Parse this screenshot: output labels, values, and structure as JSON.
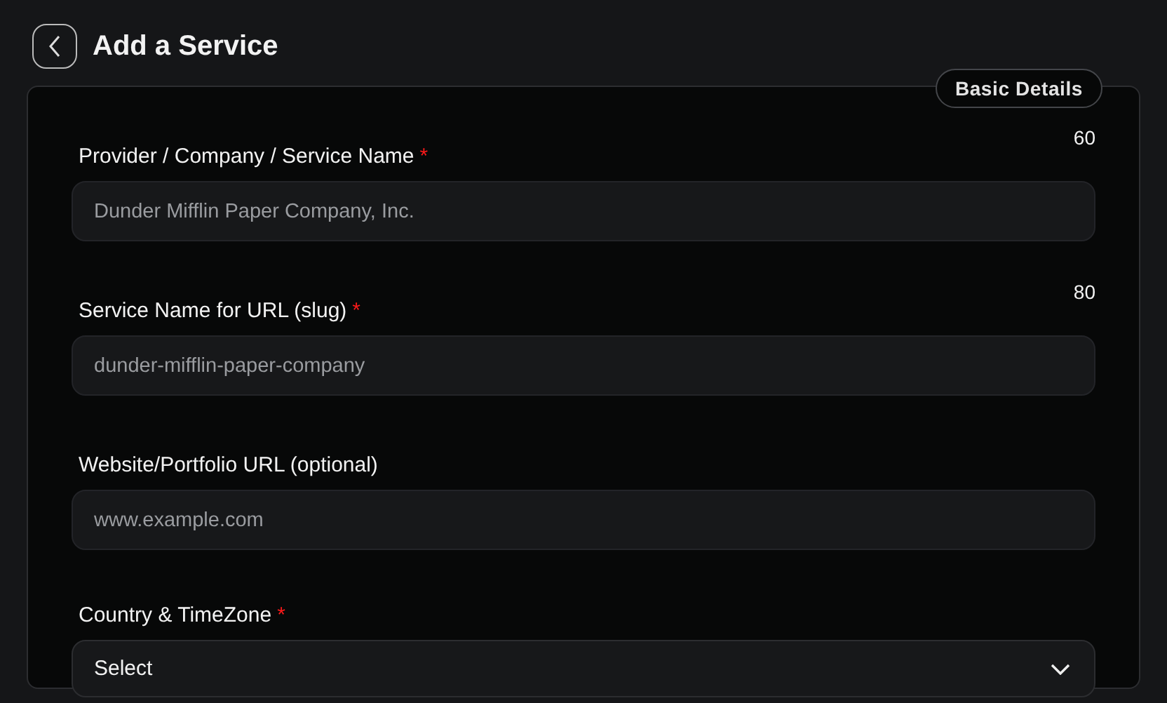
{
  "header": {
    "title": "Add a Service"
  },
  "section": {
    "badge": "Basic Details"
  },
  "fields": [
    {
      "kind": "text",
      "label": "Provider / Company / Service Name",
      "required_mark": "*",
      "counter": "60",
      "placeholder": "Dunder Mifflin Paper Company, Inc."
    },
    {
      "kind": "text",
      "label": "Service Name for URL (slug)",
      "required_mark": "*",
      "counter": "80",
      "placeholder": "dunder-mifflin-paper-company"
    },
    {
      "kind": "text",
      "label": "Website/Portfolio URL (optional)",
      "placeholder": "www.example.com"
    },
    {
      "kind": "select",
      "label": "Country & TimeZone",
      "required_mark": "*",
      "value": "Select"
    }
  ]
}
